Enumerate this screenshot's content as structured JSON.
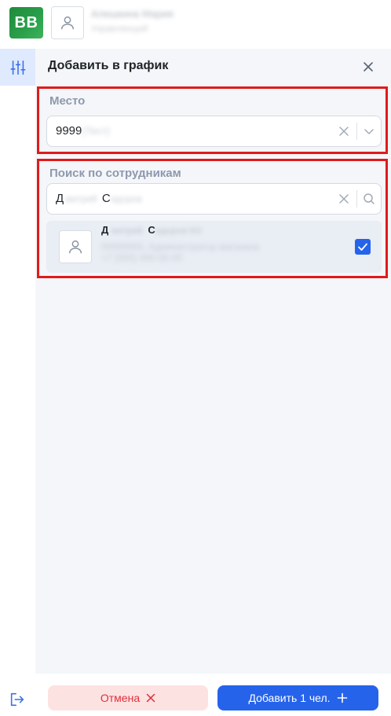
{
  "header": {
    "logo_text": "BB",
    "user_name": "Алешкина Мария",
    "user_role": "Управляющий"
  },
  "panel": {
    "title": "Добавить в график",
    "place": {
      "label": "Место",
      "value_visible": "9999",
      "value_hidden": " (Тест)"
    },
    "search": {
      "label": "Поиск по сотрудникам",
      "query_first": "Д",
      "query_first_hidden": "митрий",
      "query_second": "С",
      "query_second_hidden": "идоров"
    },
    "employee": {
      "name_first": "Д",
      "name_first_hidden": "митрий",
      "name_second": "С",
      "name_second_hidden": "идоров КО",
      "line2": "00000000, Администратор магазина",
      "line3": "+7 (000) 000-00-00",
      "selected": true
    }
  },
  "footer": {
    "cancel_label": "Отмена",
    "add_label": "Добавить 1 чел."
  },
  "colors": {
    "accent": "#2563eb",
    "cancel_bg": "#fde2e2",
    "cancel_text": "#e0303a",
    "highlight_border": "#e01b1b",
    "logo_green": "#2aa04b"
  }
}
